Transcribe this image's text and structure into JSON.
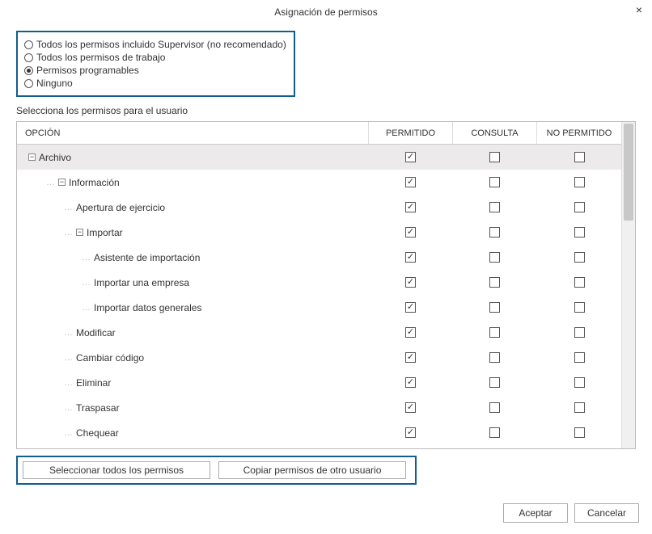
{
  "title": "Asignación de permisos",
  "close_label": "×",
  "radios": {
    "all_inc_supervisor": "Todos los permisos incluido Supervisor (no recomendado)",
    "all_work": "Todos los permisos de trabajo",
    "programmable": "Permisos programables",
    "none": "Ninguno",
    "selected": "programmable"
  },
  "select_label": "Selecciona los permisos para el usuario",
  "columns": {
    "option": "OPCIÓN",
    "allowed": "PERMITIDO",
    "query": "CONSULTA",
    "not_allowed": "NO PERMITIDO"
  },
  "rows": [
    {
      "label": "Archivo",
      "level": 0,
      "expander": "−",
      "allowed": true,
      "query": false,
      "not_allowed": false,
      "top": true
    },
    {
      "label": "Información",
      "level": 1,
      "expander": "−",
      "allowed": true,
      "query": false,
      "not_allowed": false
    },
    {
      "label": "Apertura de ejercicio",
      "level": 2,
      "expander": null,
      "allowed": true,
      "query": false,
      "not_allowed": false
    },
    {
      "label": "Importar",
      "level": 2,
      "expander": "−",
      "allowed": true,
      "query": false,
      "not_allowed": false
    },
    {
      "label": "Asistente de importación",
      "level": 3,
      "expander": null,
      "allowed": true,
      "query": false,
      "not_allowed": false
    },
    {
      "label": "Importar una empresa",
      "level": 3,
      "expander": null,
      "allowed": true,
      "query": false,
      "not_allowed": false
    },
    {
      "label": "Importar datos generales",
      "level": 3,
      "expander": null,
      "allowed": true,
      "query": false,
      "not_allowed": false
    },
    {
      "label": "Modificar",
      "level": 2,
      "expander": null,
      "allowed": true,
      "query": false,
      "not_allowed": false
    },
    {
      "label": "Cambiar código",
      "level": 2,
      "expander": null,
      "allowed": true,
      "query": false,
      "not_allowed": false
    },
    {
      "label": "Eliminar",
      "level": 2,
      "expander": null,
      "allowed": true,
      "query": false,
      "not_allowed": false
    },
    {
      "label": "Traspasar",
      "level": 2,
      "expander": null,
      "allowed": true,
      "query": false,
      "not_allowed": false
    },
    {
      "label": "Chequear",
      "level": 2,
      "expander": null,
      "allowed": true,
      "query": false,
      "not_allowed": false
    }
  ],
  "buttons": {
    "select_all": "Seleccionar todos los permisos",
    "copy_from": "Copiar permisos de otro usuario",
    "accept": "Aceptar",
    "cancel": "Cancelar"
  }
}
